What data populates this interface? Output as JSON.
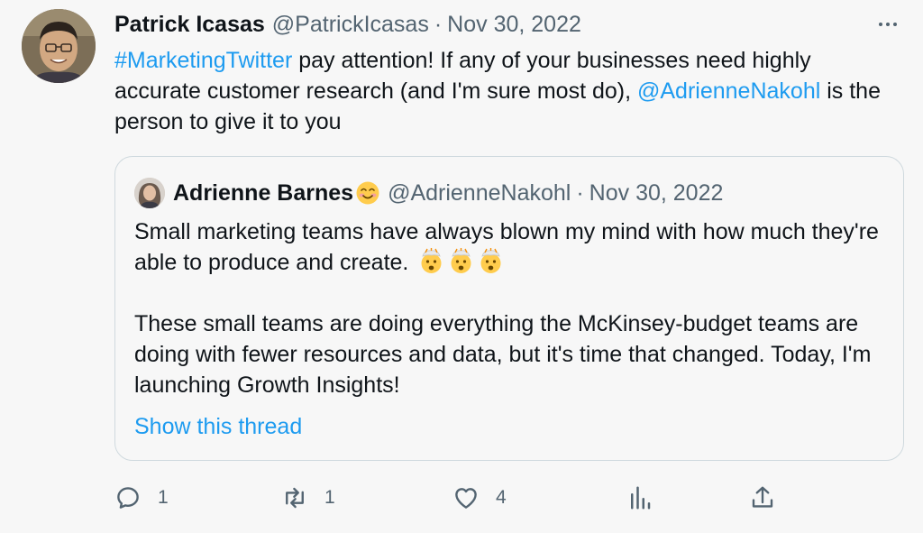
{
  "tweet": {
    "author_name": "Patrick Icasas",
    "author_handle": "@PatrickIcasas",
    "separator": "·",
    "date": "Nov 30, 2022",
    "hashtag": "#MarketingTwitter",
    "text_1": " pay attention! If any of your businesses need highly accurate customer research (and I'm sure most do), ",
    "mention": "@AdrienneNakohl",
    "text_2": " is the person to give it to you"
  },
  "quoted": {
    "author_name": "Adrienne Barnes",
    "author_handle": "@AdrienneNakohl",
    "separator": "·",
    "date": "Nov 30, 2022",
    "paragraph_1": "Small marketing teams have always blown my mind with how much they're able to produce and create.",
    "paragraph_2": "These small teams are doing everything the McKinsey-budget teams are doing with fewer resources and data, but it's time that changed. Today, I'm launching Growth Insights!",
    "show_thread": "Show this thread"
  },
  "actions": {
    "replies": "1",
    "retweets": "1",
    "likes": "4"
  },
  "icons": {
    "more": "more-horizontal-icon",
    "reply": "reply-icon",
    "retweet": "retweet-icon",
    "like": "heart-icon",
    "analytics": "analytics-icon",
    "share": "share-icon"
  },
  "colors": {
    "link": "#1d9bf0",
    "muted": "#536471",
    "border": "#cfd9de",
    "background": "#f7f7f7"
  }
}
